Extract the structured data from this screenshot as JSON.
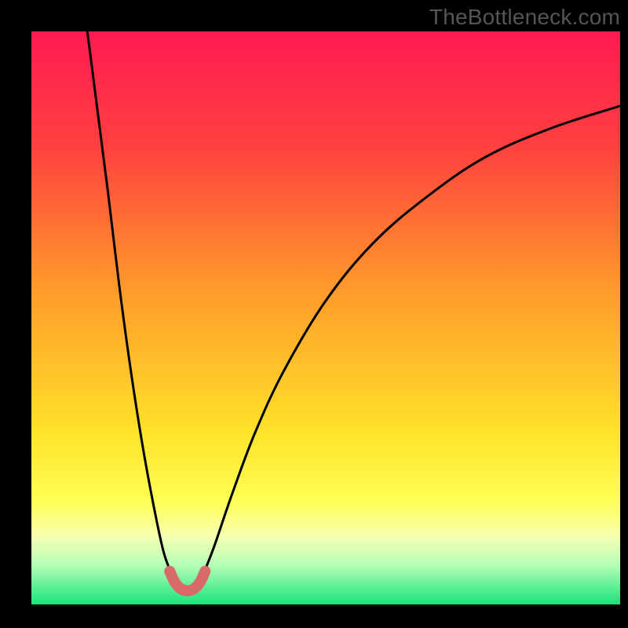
{
  "watermark": "TheBottleneck.com",
  "chart_data": {
    "type": "line",
    "title": "",
    "xlabel": "",
    "ylabel": "",
    "xlim": [
      0,
      100
    ],
    "ylim": [
      0,
      100
    ],
    "grid": false,
    "legend": null,
    "gradient_stops": [
      {
        "offset": 0,
        "color": "#ff1a53"
      },
      {
        "offset": 20,
        "color": "#ff4040"
      },
      {
        "offset": 45,
        "color": "#ff9a2a"
      },
      {
        "offset": 70,
        "color": "#ffe22a"
      },
      {
        "offset": 82,
        "color": "#ffff55"
      },
      {
        "offset": 88,
        "color": "#f7ffb0"
      },
      {
        "offset": 93,
        "color": "#b8ffb8"
      },
      {
        "offset": 100,
        "color": "#19e37a"
      }
    ],
    "series": [
      {
        "name": "left-curve",
        "stroke": "#000000",
        "stroke_width": 3,
        "fill": null,
        "points": [
          {
            "x": 9.5,
            "y": 100
          },
          {
            "x": 11,
            "y": 88
          },
          {
            "x": 13,
            "y": 72
          },
          {
            "x": 15,
            "y": 55
          },
          {
            "x": 17,
            "y": 40
          },
          {
            "x": 19,
            "y": 27
          },
          {
            "x": 21,
            "y": 16
          },
          {
            "x": 22.5,
            "y": 9
          },
          {
            "x": 24,
            "y": 4.8
          }
        ]
      },
      {
        "name": "right-curve",
        "stroke": "#000000",
        "stroke_width": 3,
        "fill": null,
        "points": [
          {
            "x": 29,
            "y": 4.8
          },
          {
            "x": 31,
            "y": 10
          },
          {
            "x": 34,
            "y": 19
          },
          {
            "x": 38,
            "y": 30
          },
          {
            "x": 43,
            "y": 41
          },
          {
            "x": 50,
            "y": 53
          },
          {
            "x": 58,
            "y": 63
          },
          {
            "x": 67,
            "y": 71
          },
          {
            "x": 77,
            "y": 78
          },
          {
            "x": 88,
            "y": 83
          },
          {
            "x": 100,
            "y": 87
          }
        ]
      },
      {
        "name": "valley-marker",
        "stroke": "#d86a6a",
        "stroke_width": 14,
        "fill": null,
        "linecap": "round",
        "points": [
          {
            "x": 23.5,
            "y": 5.8
          },
          {
            "x": 24.3,
            "y": 4.0
          },
          {
            "x": 25.3,
            "y": 2.8
          },
          {
            "x": 26.5,
            "y": 2.4
          },
          {
            "x": 27.7,
            "y": 2.8
          },
          {
            "x": 28.7,
            "y": 4.0
          },
          {
            "x": 29.5,
            "y": 5.8
          }
        ]
      }
    ]
  }
}
